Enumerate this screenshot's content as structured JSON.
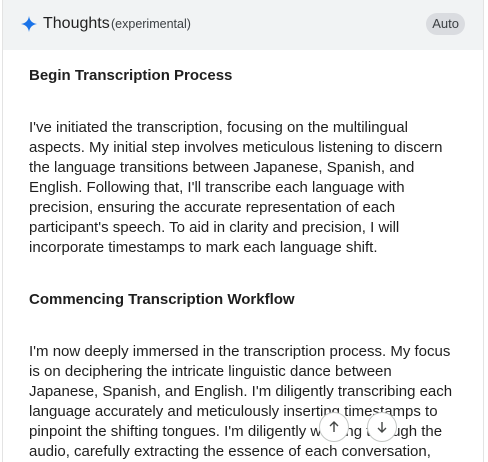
{
  "header": {
    "title": "Thoughts",
    "subtitle": "(experimental)",
    "auto_label": "Auto"
  },
  "sections": [
    {
      "heading": "Begin Transcription Process",
      "body": "I've initiated the transcription, focusing on the multilingual aspects. My initial step involves meticulous listening to discern the language transitions between Japanese, Spanish, and English. Following that, I'll transcribe each language with precision, ensuring the accurate representation of each participant's speech. To aid in clarity and precision, I will incorporate timestamps to mark each language shift."
    },
    {
      "heading": "Commencing Transcription Workflow",
      "body": "I'm now deeply immersed in the transcription process. My focus is on deciphering the intricate linguistic dance between Japanese, Spanish, and English. I'm diligently transcribing each language accurately and meticulously inserting timestamps to pinpoint the shifting tongues. I'm diligently working through the audio, carefully extracting the essence of each conversation,"
    }
  ],
  "icons": {
    "sparkle": "sparkle-icon",
    "scroll_up": "arrow-up-icon",
    "scroll_down": "arrow-down-icon"
  },
  "colors": {
    "accent": "#1a73e8",
    "header_bg": "#f1f3f4"
  }
}
